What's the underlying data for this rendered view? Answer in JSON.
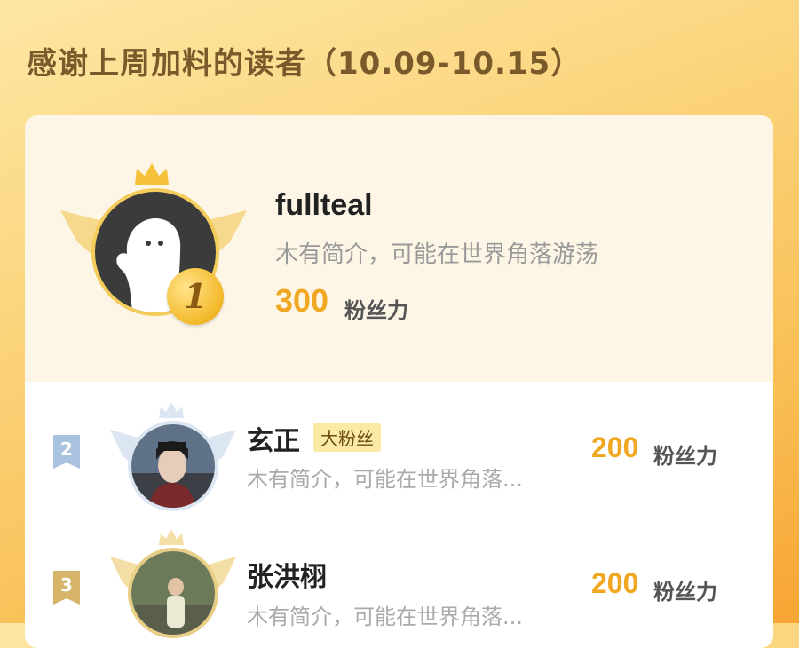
{
  "header": {
    "title": "感谢上周加料的读者（10.09-10.15）"
  },
  "top_reader": {
    "rank": "1",
    "name": "fullteal",
    "bio": "木有简介，可能在世界角落游荡",
    "score": "300",
    "score_unit": "粉丝力"
  },
  "readers": [
    {
      "rank": "2",
      "name": "玄正",
      "badge": "大粉丝",
      "bio": "木有简介，可能在世界角落...",
      "score": "200",
      "score_unit": "粉丝力"
    },
    {
      "rank": "3",
      "name": "张洪栩",
      "bio": "木有简介，可能在世界角落...",
      "score": "200",
      "score_unit": "粉丝力"
    }
  ],
  "colors": {
    "accent": "#f0a722",
    "title": "#7a5a2a",
    "rank2": "#a9c3df",
    "rank3": "#d6b56a"
  }
}
